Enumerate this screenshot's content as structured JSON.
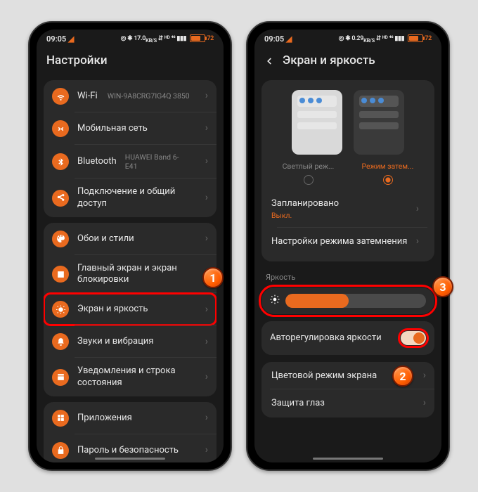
{
  "status": {
    "time": "09:05",
    "net": "17.0",
    "net_unit": "KB/S",
    "battery": "72",
    "net2": "0.29",
    "net_unit2": "KB/S"
  },
  "left": {
    "title": "Настройки",
    "wifi": {
      "label": "Wi-Fi",
      "value": "WIN-9A8CRG7IG4Q 3850"
    },
    "mobile": "Мобильная сеть",
    "bt": {
      "label": "Bluetooth",
      "value": "HUAWEI Band 6-E41"
    },
    "conn": "Подключение и общий доступ",
    "wall": "Обои и стили",
    "home": "Главный экран и экран блокировки",
    "display": "Экран и яркость",
    "sound": "Звуки и вибрация",
    "notif": "Уведомления и строка состояния",
    "apps": "Приложения",
    "security": "Пароль и безопасность"
  },
  "right": {
    "title": "Экран и яркость",
    "mode_light": "Светлый реж...",
    "mode_dark": "Режим затем...",
    "scheduled": {
      "label": "Запланировано",
      "value": "Выкл."
    },
    "dark_settings": "Настройки режима затемнения",
    "brightness_section": "Яркость",
    "auto_brightness": "Авторегулировка яркости",
    "color_mode": "Цветовой режим экрана",
    "eye": "Защита глаз"
  },
  "badges": {
    "one": "1",
    "two": "2",
    "three": "3"
  }
}
